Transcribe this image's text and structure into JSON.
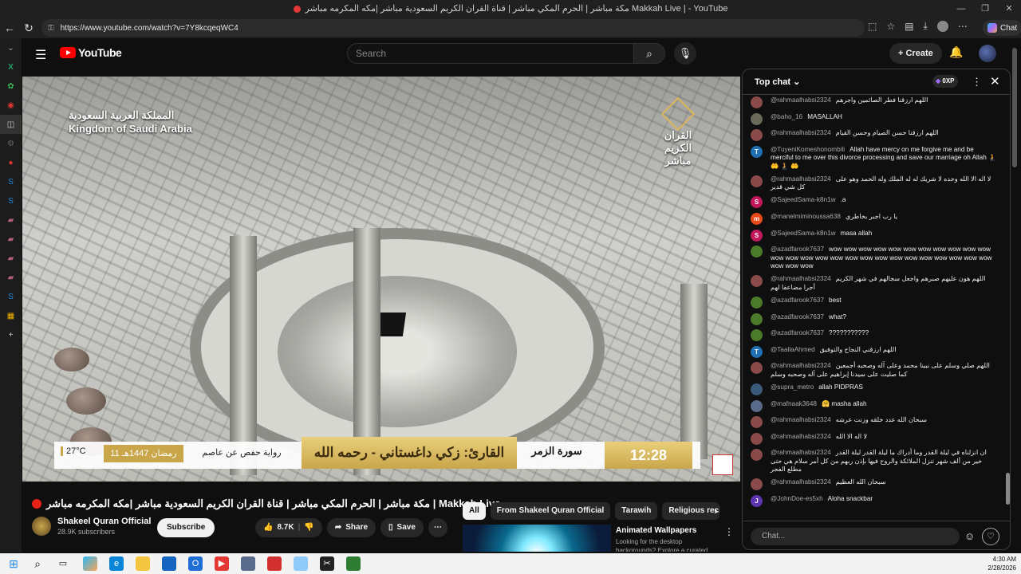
{
  "browser": {
    "window_title": "مكة مباشر | الحرم المكي مباشر | قناة القران الكريم السعودية مباشر |مكه المكرمه مباشر Makkah Live | - YouTube",
    "url": "https://www.youtube.com/watch?v=7Y8kcqeqWC4",
    "chat_button": "Chat"
  },
  "yt": {
    "logo": "YouTube",
    "search_placeholder": "Search",
    "create_label": "Create"
  },
  "video_overlay": {
    "country_ar": "المملكة العربية السعودية",
    "country_en": "Kingdom of Saudi Arabia",
    "channel_ar": "القران الكريم مباشر",
    "temperature": "27°C",
    "date": "11 رمضان 1447هـ",
    "riwaya": "رواية حفص عن عاصم",
    "reciter": "القارئ: زكي داغستاني - رحمه الله",
    "surah": "سورة الزمر",
    "time": "12:28"
  },
  "video": {
    "title": "مكة مباشر | الحرم المكي مباشر | قناة القران الكريم السعودية مباشر |مكه المكرمه مباشر | Makkah Live",
    "channel_name": "Shakeel Quran Official",
    "subscribers": "28.9K subscribers",
    "subscribe_label": "Subscribe",
    "likes": "8.7K",
    "share_label": "Share",
    "save_label": "Save"
  },
  "chips": [
    "All",
    "From Shakeel Quran Official",
    "Tarawih",
    "Religious recitat"
  ],
  "recommendation": {
    "title": "Animated Wallpapers",
    "subtitle": "Looking for the desktop backgrounds? Explore a curated"
  },
  "chat": {
    "header": "Top chat",
    "points": "0XP",
    "input_placeholder": "Chat...",
    "messages": [
      {
        "author": "@rahmaalhabsi2324",
        "text": "اللهم ارزقنا فطر الصائمين واجرهم",
        "color": "#8a4a4a",
        "initial": "",
        "rtl": true
      },
      {
        "author": "@baho_16",
        "text": "MASALLAH",
        "color": "#6a6a5a",
        "initial": "",
        "rtl": false
      },
      {
        "author": "@rahmaalhabsi2324",
        "text": "اللهم ارزقنا حسن الصيام وحسن القيام",
        "color": "#8a4a4a",
        "initial": "",
        "rtl": true
      },
      {
        "author": "@TuyeniKomeshonombili",
        "text": "Allah have mercy on me forgive me and be merciful to me over this divorce processing and save our marriage oh Allah 🧎 🤲 🧎 🤲",
        "color": "#1f6fb2",
        "initial": "T",
        "rtl": false
      },
      {
        "author": "@rahmaalhabsi2324",
        "text": "لا اله الا الله وحده لا شريك له له الملك وله الحمد وهو على كل شي قدير",
        "color": "#8a4a4a",
        "initial": "",
        "rtl": true
      },
      {
        "author": "@SajeedSama-k8n1w",
        "text": ".a",
        "color": "#c2185b",
        "initial": "S",
        "rtl": false
      },
      {
        "author": "@manelmiminoussa638",
        "text": "يا رب اجبر بخاطري",
        "color": "#e64a19",
        "initial": "m",
        "rtl": true
      },
      {
        "author": "@SajeedSama-k8n1w",
        "text": "masa allah",
        "color": "#c2185b",
        "initial": "S",
        "rtl": false
      },
      {
        "author": "@azadfarook7637",
        "text": "wow wow wow wow wow wow wow wow wow wow wow wow wow wow wow wow wow wow wow wow wow wow wow wow wow wow wow wow wow",
        "color": "#4a7a2a",
        "initial": "",
        "rtl": false
      },
      {
        "author": "@rahmaalhabsi2324",
        "text": "اللهم هون عليهم صبرهم واجعل سجالهم في شهر الكريم أجرا مضاعفا لهم",
        "color": "#8a4a4a",
        "initial": "",
        "rtl": true
      },
      {
        "author": "@azadfarook7637",
        "text": "best",
        "color": "#4a7a2a",
        "initial": "",
        "rtl": false
      },
      {
        "author": "@azadfarook7637",
        "text": "what?",
        "color": "#4a7a2a",
        "initial": "",
        "rtl": false
      },
      {
        "author": "@azadfarook7637",
        "text": "???????????",
        "color": "#4a7a2a",
        "initial": "",
        "rtl": false
      },
      {
        "author": "@TaaliaAhmed",
        "text": "اللهم ارزقني النجاح والتوفيق",
        "color": "#1f6fb2",
        "initial": "T",
        "rtl": true
      },
      {
        "author": "@rahmaalhabsi2324",
        "text": "اللهم صلي وسلم على نبينا محمد وعلى آله وصحبه أجمعين كما صليت على سيدنا إبراهيم على آله وصحبه وسلم",
        "color": "#8a4a4a",
        "initial": "",
        "rtl": true
      },
      {
        "author": "@supra_metro",
        "text": "allah PIDPRAS",
        "color": "#3a5a7a",
        "initial": "",
        "rtl": false
      },
      {
        "author": "@mafnaak3648",
        "text": "🤗 masha allah",
        "color": "#5a6a8a",
        "initial": "",
        "rtl": false
      },
      {
        "author": "@rahmaalhabsi2324",
        "text": "سبحان الله عدد خلقه وزنت عرشه",
        "color": "#8a4a4a",
        "initial": "",
        "rtl": true
      },
      {
        "author": "@rahmaalhabsi2324",
        "text": "لا اله الا الله",
        "color": "#8a4a4a",
        "initial": "",
        "rtl": true
      },
      {
        "author": "@rahmaalhabsi2324",
        "text": "ان انزلناه في ليلة القدر وما أدراك ما ليلة القدر ليلة القدر خير من ألف شهر تنزل الملائكة والروح فيها بإذن ربهم من كل أمر سلام هي حتى مطلع الفجر",
        "color": "#8a4a4a",
        "initial": "",
        "rtl": true
      },
      {
        "author": "@rahmaalhabsi2324",
        "text": "سبحان الله العظيم",
        "color": "#8a4a4a",
        "initial": "",
        "rtl": true
      },
      {
        "author": "@JohnDoe-es5xh",
        "text": "Aloha snackbar",
        "color": "#5e35b1",
        "initial": "J",
        "rtl": false
      }
    ]
  },
  "taskbar": {
    "time": "4:30 AM",
    "date": "2/28/2026"
  }
}
